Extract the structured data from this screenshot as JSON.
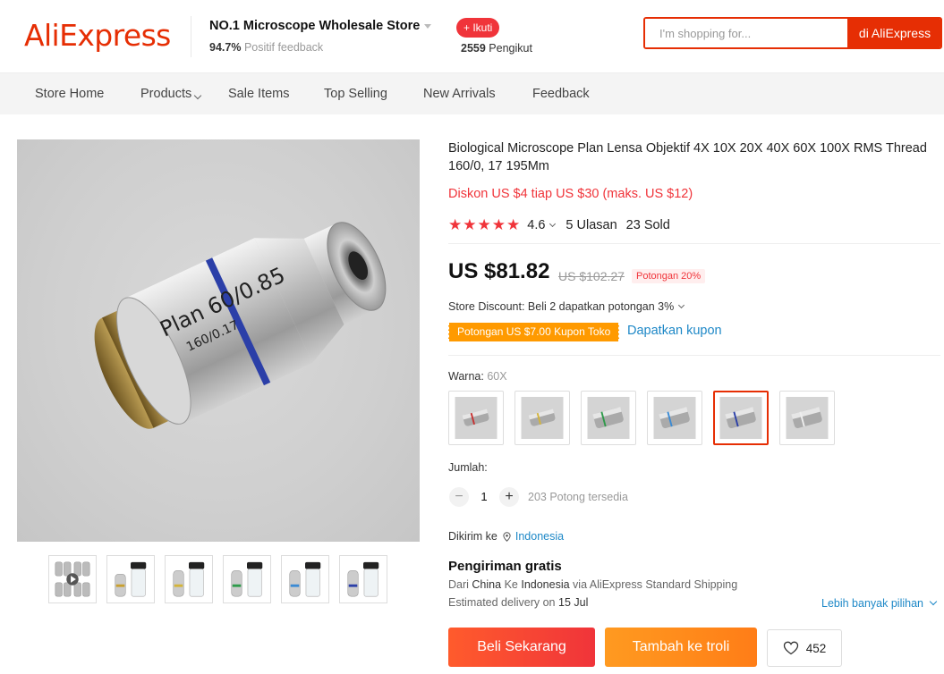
{
  "header": {
    "logo": "AliExpress",
    "store_name": "NO.1 Microscope Wholesale Store",
    "positive_pct": "94.7%",
    "positive_label": "Positif feedback",
    "follow_label": "+ Ikuti",
    "followers_count": "2559",
    "followers_label": "Pengikut",
    "search_placeholder": "I'm shopping for...",
    "search_button": "di AliExpress"
  },
  "nav": {
    "items": [
      "Store Home",
      "Products",
      "Sale Items",
      "Top Selling",
      "New Arrivals",
      "Feedback"
    ]
  },
  "product": {
    "title": "Biological Microscope Plan Lensa Objektif 4X 10X 20X 40X 60X 100X RMS Thread 160/0, 17 195Mm",
    "discount_note": "Diskon US $4 tiap US $30 (maks. US $12)",
    "rating": "4.6",
    "reviews": "5 Ulasan",
    "sold": "23 Sold",
    "stars_filled": 5,
    "price": "US $81.82",
    "old_price": "US $102.27",
    "discount_badge": "Potongan 20%",
    "store_discount": "Store Discount: Beli 2 dapatkan potongan 3%",
    "coupon_tag": "Potongan US $7.00 Kupon Toko",
    "get_coupon": "Dapatkan kupon",
    "color_label": "Warna:",
    "color_value": "60X",
    "selected_swatch_index": 4,
    "quantity_label": "Jumlah:",
    "quantity": "1",
    "qty_minus": "−",
    "qty_plus": "+",
    "available": "203 Potong tersedia",
    "ship_to_label": "Dikirim ke",
    "ship_to_country": "Indonesia",
    "free_shipping": "Pengiriman gratis",
    "route_from": "Dari",
    "route_origin": "China",
    "route_to": "Ke",
    "route_dest": "Indonesia",
    "route_via": "via AliExpress Standard Shipping",
    "est_label": "Estimated delivery on",
    "est_date": "15 Jul",
    "more_options": "Lebih banyak pilihan",
    "buy_now": "Beli Sekarang",
    "add_cart": "Tambah ke troli",
    "wishlist_count": "452"
  },
  "lens_text": {
    "line1": "Plan 60/0.85",
    "line2": "160/0.17"
  },
  "colors": {
    "brand": "#e62e04",
    "accent_red": "#f0343a",
    "coupon_orange": "#ff9a00",
    "link_blue": "#1e88c7"
  }
}
